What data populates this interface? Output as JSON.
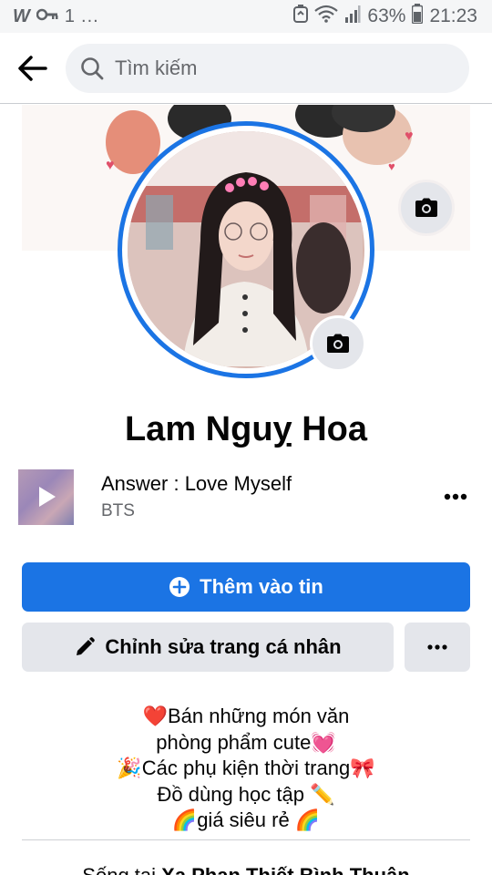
{
  "status_bar": {
    "left_icons": [
      "whatsapp-icon",
      "key-icon",
      "notification-one-icon",
      "more-notifications-icon"
    ],
    "left_w": "W",
    "left_key": "o-т",
    "left_one": "1",
    "left_dots": "...",
    "battery_percent": "63%",
    "time": "21:23"
  },
  "header": {
    "search_placeholder": "Tìm kiếm"
  },
  "profile": {
    "name": "Lam Nguỵ Hoa"
  },
  "music": {
    "title": "Answer : Love Myself",
    "artist": "BTS"
  },
  "buttons": {
    "add_story": "Thêm vào tin",
    "edit_profile": "Chỉnh sửa trang cá nhân"
  },
  "bio": {
    "lines": [
      "❤️Bán những món văn",
      "phòng phẩm cute💓",
      "🎉Các phụ kiện thời trang🎀",
      "Đồ dùng học tập ✏️",
      "🌈giá siêu rẻ 🌈"
    ]
  },
  "location": {
    "prefix": "Sống tại ",
    "place": "Xa Phan Thiết Bình Thuận"
  },
  "colors": {
    "accent": "#1b74e4",
    "secondary_button": "#e4e6eb",
    "muted_text": "#65676b"
  }
}
